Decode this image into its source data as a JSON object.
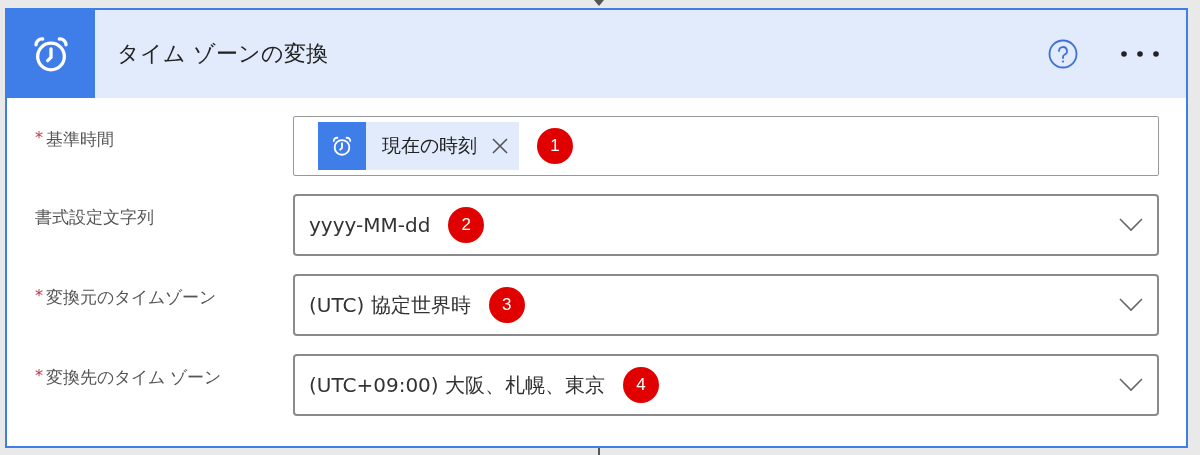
{
  "header": {
    "title": "タイム ゾーンの変換"
  },
  "fields": [
    {
      "kind": "token",
      "label": "基準時間",
      "required_mark": "*",
      "token": "現在の時刻",
      "marker": "1"
    },
    {
      "kind": "dropdown",
      "label": "書式設定文字列",
      "value": "yyyy-MM-dd",
      "marker": "2"
    },
    {
      "kind": "dropdown",
      "label": "変換元のタイムゾーン",
      "required_mark": "*",
      "value": "(UTC) 協定世界時",
      "marker": "3"
    },
    {
      "kind": "dropdown",
      "label": "変換先のタイム ゾーン",
      "required_mark": "*",
      "value": "(UTC+09:00) 大阪、札幌、東京",
      "marker": "4"
    }
  ]
}
